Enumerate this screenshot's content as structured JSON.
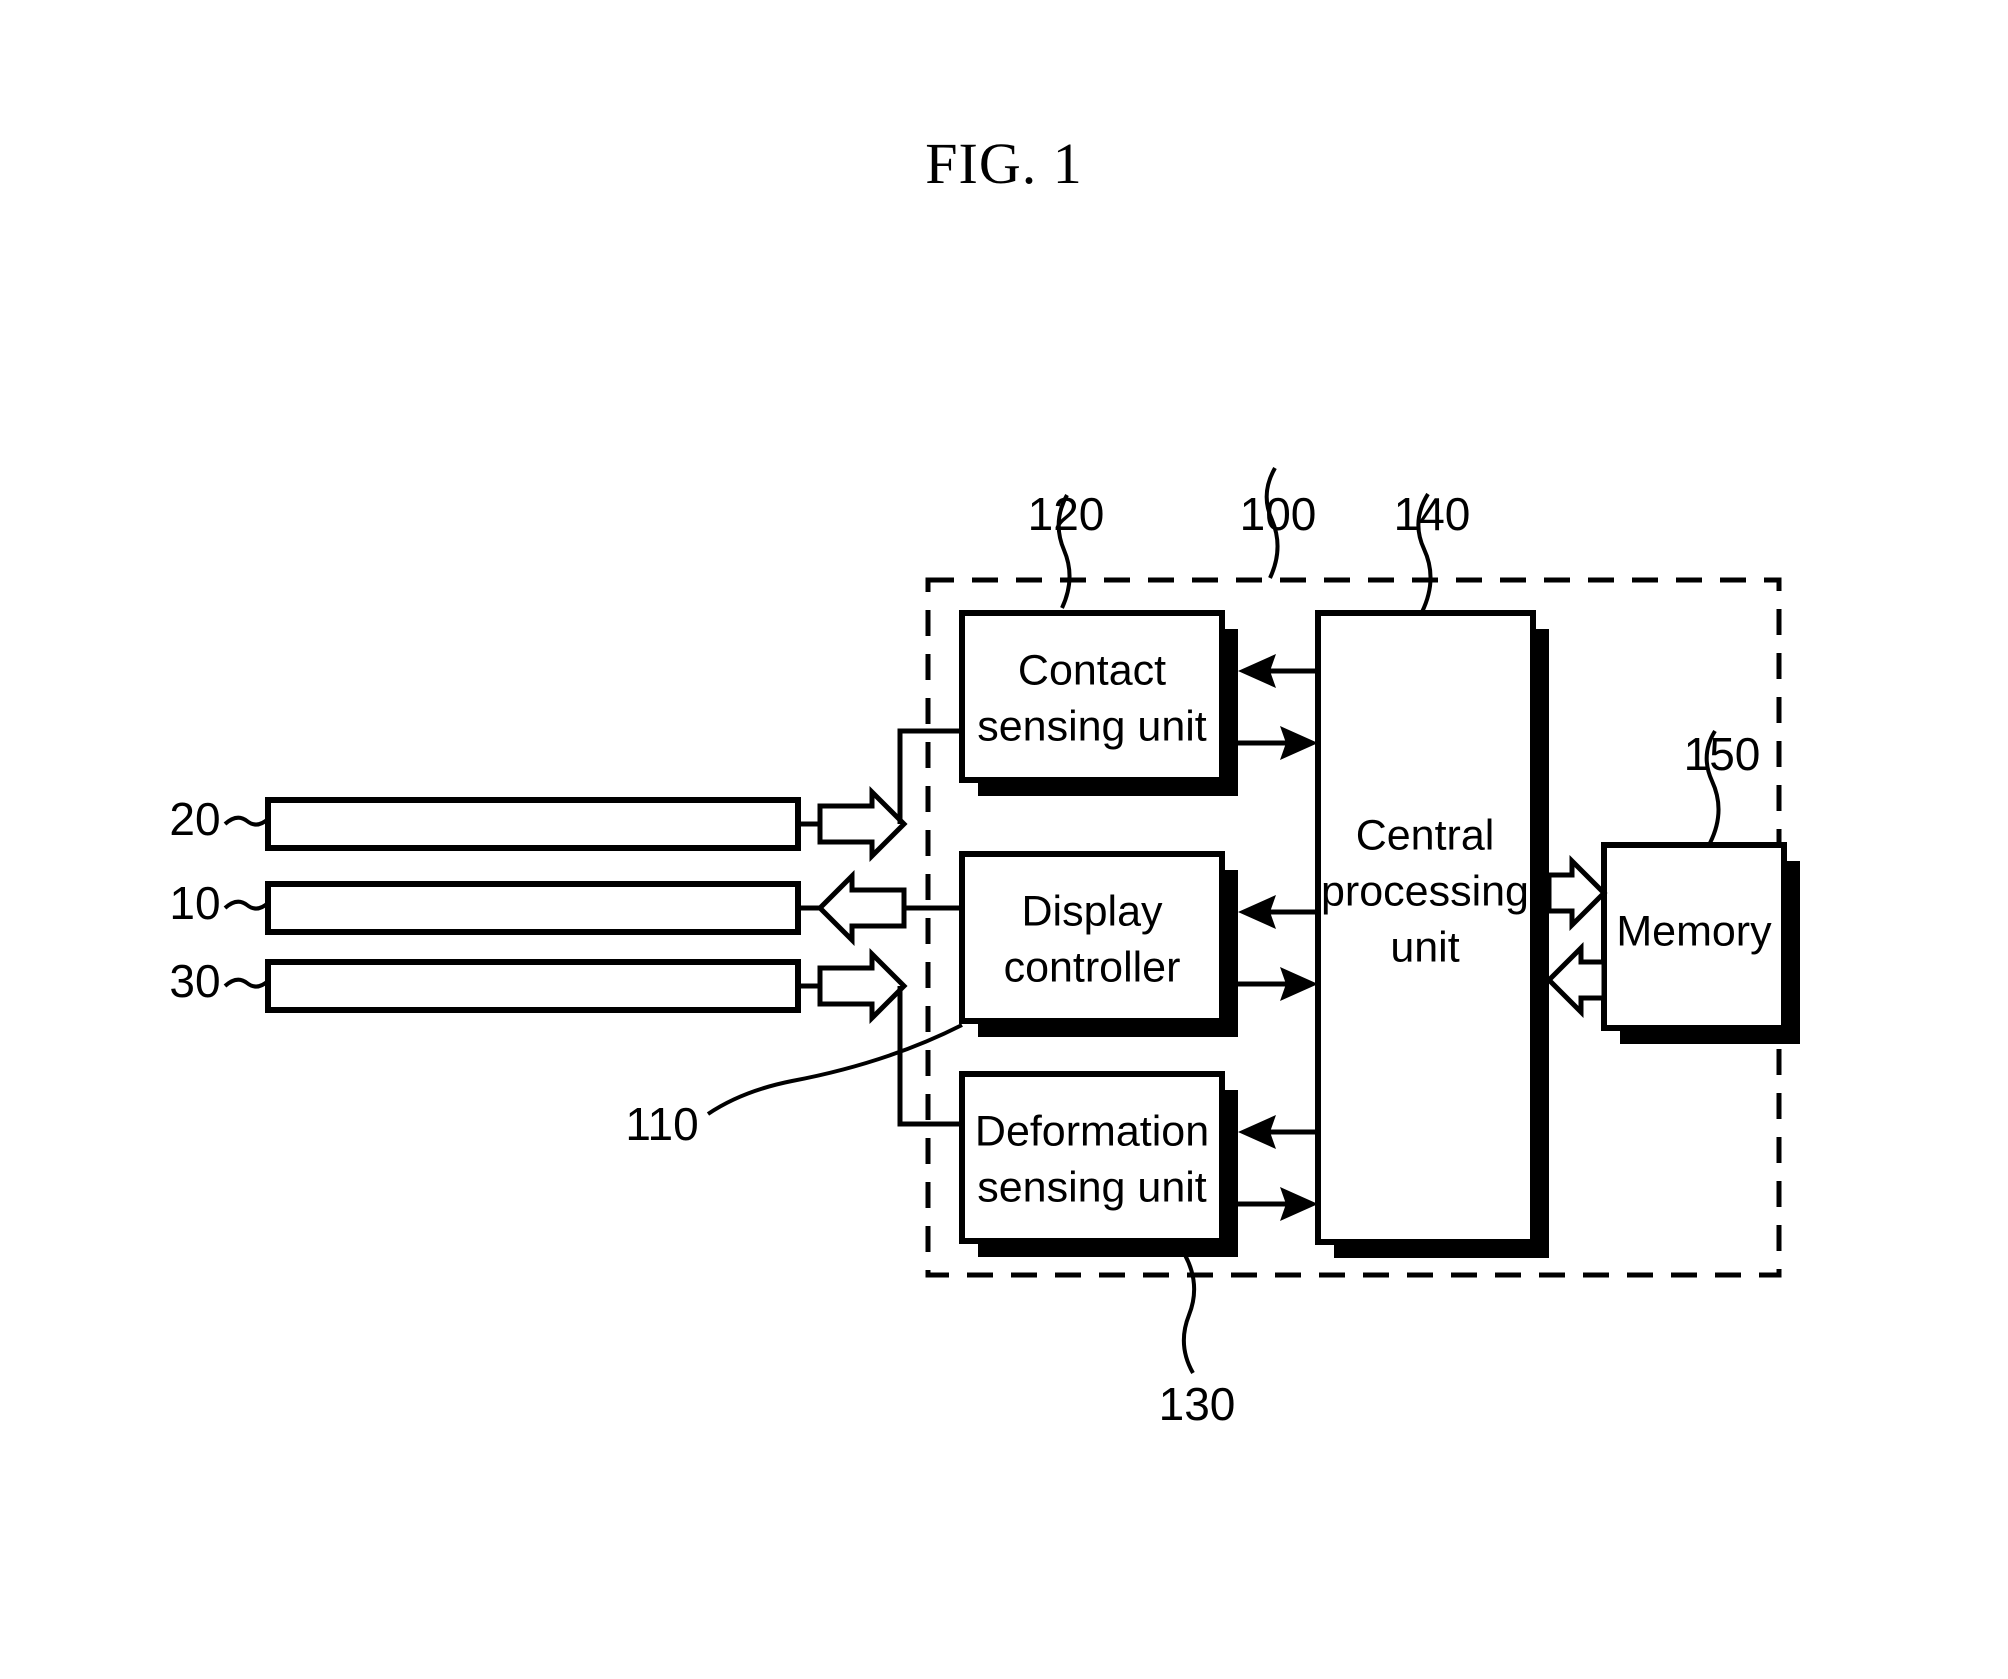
{
  "figure": {
    "title": "FIG. 1",
    "type": "patent-block-diagram"
  },
  "blocks": [
    {
      "id": "contact",
      "label_line1": "Contact",
      "label_line2": "sensing unit",
      "ref": "120"
    },
    {
      "id": "display",
      "label_line1": "Display",
      "label_line2": "controller",
      "ref": "110"
    },
    {
      "id": "deformation",
      "label_line1": "Deformation",
      "label_line2": "sensing unit",
      "ref": "130"
    },
    {
      "id": "cpu",
      "label_line1": "Central",
      "label_line2": "processing",
      "label_line3": "unit",
      "ref": "140"
    },
    {
      "id": "memory",
      "label_line1": "Memory",
      "ref": "150"
    }
  ],
  "bars": [
    {
      "id": "bar-20",
      "ref": "20",
      "direction": "right"
    },
    {
      "id": "bar-10",
      "ref": "10",
      "direction": "left"
    },
    {
      "id": "bar-30",
      "ref": "30",
      "direction": "right"
    }
  ],
  "enclosure": {
    "ref": "100",
    "style": "dashed"
  },
  "refs": {
    "r100": "100",
    "r110": "110",
    "r120": "120",
    "r130": "130",
    "r140": "140",
    "r150": "150",
    "r10": "10",
    "r20": "20",
    "r30": "30"
  },
  "colors": {
    "ink": "#000000",
    "paper": "#ffffff"
  }
}
